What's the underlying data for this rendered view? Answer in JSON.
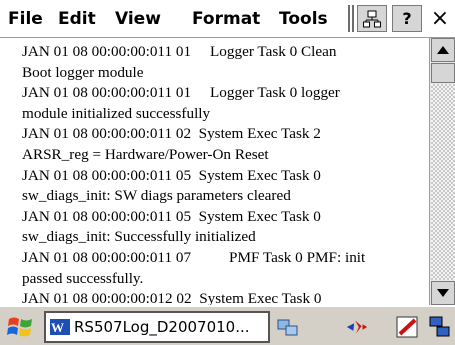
{
  "menu": {
    "file": "File",
    "edit": "Edit",
    "view": "View",
    "format": "Format",
    "tools": "Tools"
  },
  "toolbar": {
    "help_label": "?",
    "close_label": "×",
    "net_icon": "network-icon"
  },
  "log": {
    "lines": [
      "JAN 01 08 00:00:00:011 01     Logger Task 0 Clean",
      "Boot logger module",
      "JAN 01 08 00:00:00:011 01     Logger Task 0 logger",
      "module initialized successfully",
      "JAN 01 08 00:00:00:011 02  System Exec Task 2",
      "ARSR_reg = Hardware/Power-On Reset",
      "JAN 01 08 00:00:00:011 05  System Exec Task 0",
      "sw_diags_init: SW diags parameters cleared",
      "JAN 01 08 00:00:00:011 05  System Exec Task 0",
      "sw_diags_init: Successfully initialized",
      "JAN 01 08 00:00:00:011 07          PMF Task 0 PMF: init",
      "passed successfully.",
      "JAN 01 08 00:00:00:012 02  System Exec Task 0"
    ]
  },
  "taskbar": {
    "task_label": "RS507Log_D2007010...",
    "start_icon": "windows-flag-icon"
  },
  "colors": {
    "taskbar_bg": "#d4d0c8",
    "tray_red": "#cc1111"
  }
}
